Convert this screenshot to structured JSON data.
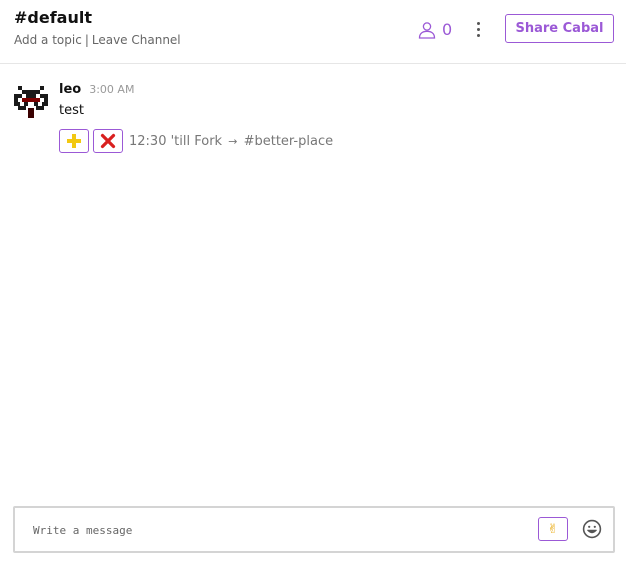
{
  "header": {
    "channel_name": "#default",
    "add_topic": "Add a topic",
    "separator": "|",
    "leave_channel": "Leave Channel",
    "member_count": "0",
    "share_label": "Share Cabal"
  },
  "messages": [
    {
      "author": "leo",
      "timestamp": "3:00 AM",
      "text": "test",
      "reaction_text": "12:30 'till Fork",
      "reaction_arrow": "→",
      "reaction_channel": "#better-place"
    }
  ],
  "composer": {
    "placeholder": "Write a message",
    "peace_emoji": "✌"
  },
  "colors": {
    "accent": "#9b59d6",
    "plus_yellow": "#f2c811",
    "cross_red": "#d9201f"
  }
}
